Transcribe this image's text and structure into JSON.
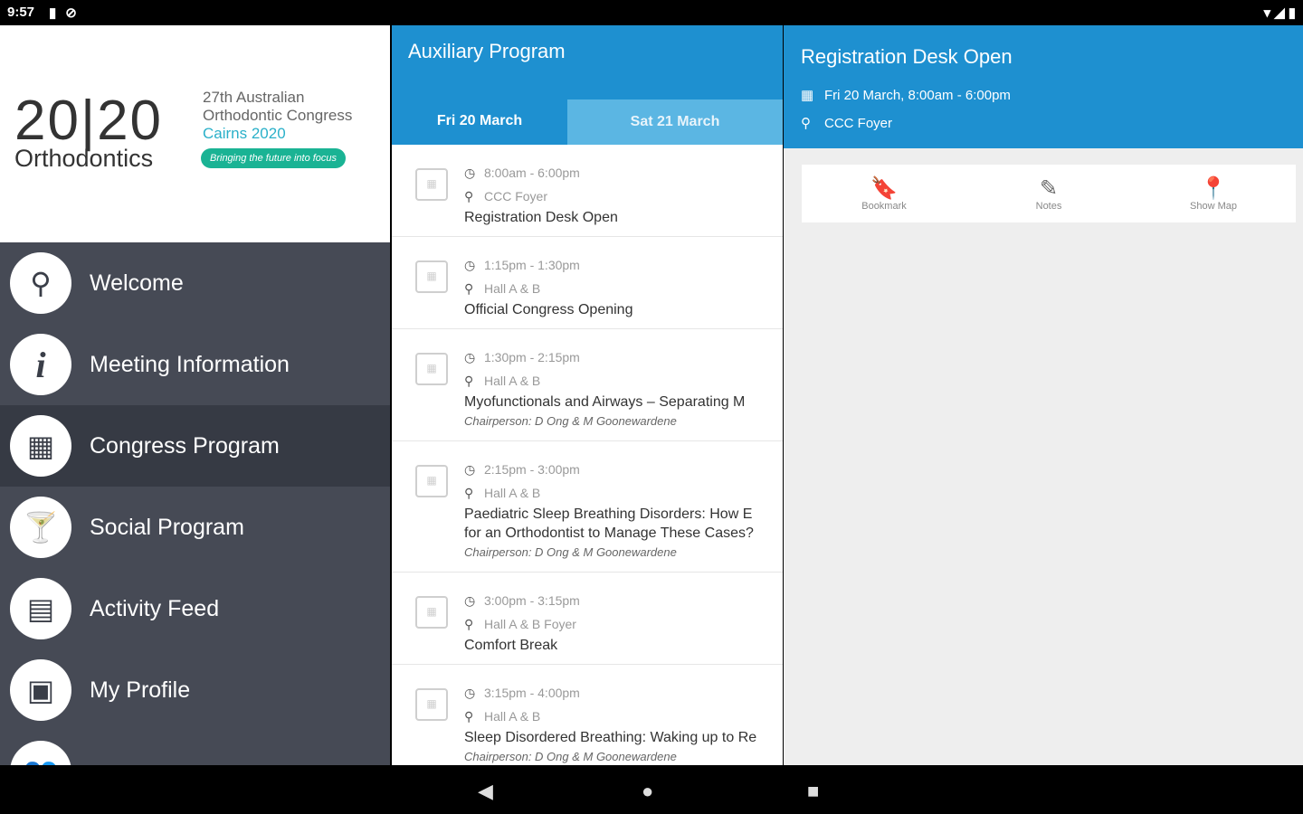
{
  "status_bar": {
    "time": "9:57"
  },
  "logo": {
    "big": "20|20",
    "word": "Orthodontics",
    "line1": "27th Australian",
    "line2": "Orthodontic Congress",
    "line3": "Cairns 2020",
    "tagline": "Bringing the future into focus"
  },
  "menu": [
    {
      "label": "Welcome",
      "icon": "search-icon",
      "glyph": "⚲"
    },
    {
      "label": "Meeting Information",
      "icon": "info-icon",
      "glyph": "i"
    },
    {
      "label": "Congress Program",
      "icon": "calendar-icon",
      "glyph": "▦"
    },
    {
      "label": "Social Program",
      "icon": "cocktail-icon",
      "glyph": "🍸"
    },
    {
      "label": "Activity Feed",
      "icon": "feed-icon",
      "glyph": "▤"
    },
    {
      "label": "My Profile",
      "icon": "profile-card-icon",
      "glyph": "▣"
    }
  ],
  "list": {
    "title": "Auxiliary Program",
    "tabs": [
      "Fri 20 March",
      "Sat 21 March"
    ],
    "entries": [
      {
        "time": "8:00am - 6:00pm",
        "location": "CCC Foyer",
        "title": "Registration Desk Open",
        "chair": ""
      },
      {
        "time": "1:15pm - 1:30pm",
        "location": "Hall A & B",
        "title": "Official Congress Opening",
        "chair": ""
      },
      {
        "time": "1:30pm - 2:15pm",
        "location": "Hall A & B",
        "title": "Myofunctionals and Airways – Separating M",
        "chair": "Chairperson: D Ong & M Goonewardene"
      },
      {
        "time": "2:15pm - 3:00pm",
        "location": "Hall A & B",
        "title": "Paediatric Sleep Breathing Disorders: How E",
        "title2": "for an Orthodontist to Manage These Cases?",
        "chair": "Chairperson: D Ong & M Goonewardene"
      },
      {
        "time": "3:00pm - 3:15pm",
        "location": "Hall A & B Foyer",
        "title": "Comfort Break",
        "chair": ""
      },
      {
        "time": "3:15pm - 4:00pm",
        "location": "Hall A & B",
        "title": "Sleep Disordered Breathing: Waking up to Re",
        "chair": "Chairperson: D Ong & M Goonewardene"
      }
    ]
  },
  "detail": {
    "title": "Registration Desk Open",
    "date": "Fri 20 March, 8:00am - 6:00pm",
    "location": "CCC Foyer",
    "actions": {
      "bookmark": "Bookmark",
      "notes": "Notes",
      "map": "Show Map"
    }
  },
  "colors": {
    "primary": "#1e90d0",
    "sidebar": "#464a55",
    "sidebar_active": "#363a44",
    "accent_green": "#1ab394"
  }
}
